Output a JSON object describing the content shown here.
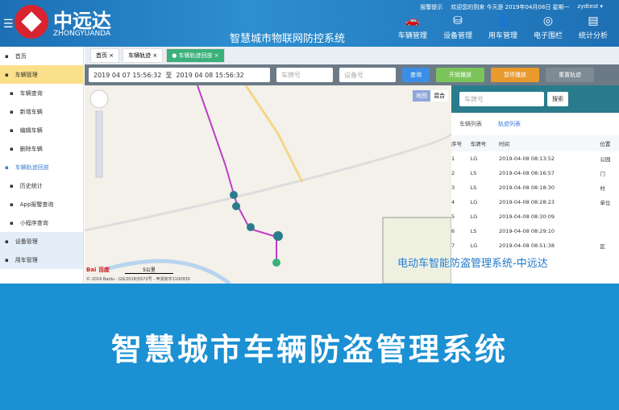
{
  "header": {
    "brand": "中远达",
    "brand_en": "ZHONGYUANDA",
    "system_title": "智慧城市物联网防控系统",
    "top_info": [
      "报警提示",
      "欢迎您的到来 今天是 2019年04月08日 星期一",
      "zydtest ▾"
    ],
    "nav": [
      {
        "label": "车辆管理",
        "icon": "car-icon"
      },
      {
        "label": "设备管理",
        "icon": "device-icon"
      },
      {
        "label": "用车管理",
        "icon": "driver-icon"
      },
      {
        "label": "电子围栏",
        "icon": "fence-icon"
      },
      {
        "label": "统计分析",
        "icon": "chart-icon"
      }
    ]
  },
  "tabs": [
    {
      "label": "首页 ×"
    },
    {
      "label": "车辆轨迹 ×"
    },
    {
      "label": "● 车辆轨迹回放 ×"
    }
  ],
  "sidebar": {
    "items": [
      {
        "label": "首页",
        "type": "top"
      },
      {
        "label": "车辆管理",
        "type": "grp"
      },
      {
        "label": "车辆查询",
        "type": "sub"
      },
      {
        "label": "新增车辆",
        "type": "sub"
      },
      {
        "label": "编辑车辆",
        "type": "sub"
      },
      {
        "label": "删除车辆",
        "type": "sub"
      },
      {
        "label": "车辆轨迹回放",
        "type": "cur"
      },
      {
        "label": "历史统计",
        "type": "sub"
      },
      {
        "label": "App报警查询",
        "type": "sub"
      },
      {
        "label": "小程序查询",
        "type": "sub"
      },
      {
        "label": "设备管理",
        "type": "bot"
      },
      {
        "label": "用车管理",
        "type": "bot"
      }
    ]
  },
  "filter": {
    "start": "2019 04 07 15:56:32",
    "to": "至",
    "end": "2019 04 08 15:56:32",
    "plate_placeholder": "车牌号",
    "device_placeholder": "设备号",
    "query": "查询",
    "play": "开始播放",
    "pause": "暂停播放",
    "reset": "重置轨迹"
  },
  "map": {
    "type_normal": "地图",
    "type_hybrid": "混合",
    "copyright": "© 2019 Baidu - GS(2018)5572号 - 甲测资字1100930",
    "scale": "5公里",
    "baidu": "Bai 百度"
  },
  "panel": {
    "search_placeholder": "车牌号",
    "search": "搜索",
    "tab_list": "车辆列表",
    "tab_track": "轨迹列表",
    "columns": [
      "序号",
      "车牌号",
      "时间",
      "位置"
    ],
    "rows": [
      [
        "1",
        "LG",
        "2019-04-08 08:13:52",
        "公园"
      ],
      [
        "2",
        "LS",
        "2019-04-08 08:16:57",
        "门"
      ],
      [
        "3",
        "LS",
        "2019-04-08 08:18:30",
        "村"
      ],
      [
        "4",
        "LG",
        "2019-04-08 08:28:23",
        "单位"
      ],
      [
        "5",
        "LG",
        "2019-04-08 08:30:09",
        ""
      ],
      [
        "6",
        "LS",
        "2019-04-08 08:29:10",
        ""
      ],
      [
        "7",
        "LG",
        "2019-04-08 08:51:38",
        "区"
      ]
    ]
  },
  "overlay_caption": "电动车智能防盗管理系统-中远达",
  "banner": "智慧城市车辆防盗管理系统",
  "colors": {
    "header": "#1d6fb4",
    "banner": "#1b90d2",
    "route": "#c03cc8",
    "marker": "#2a7b8c"
  }
}
